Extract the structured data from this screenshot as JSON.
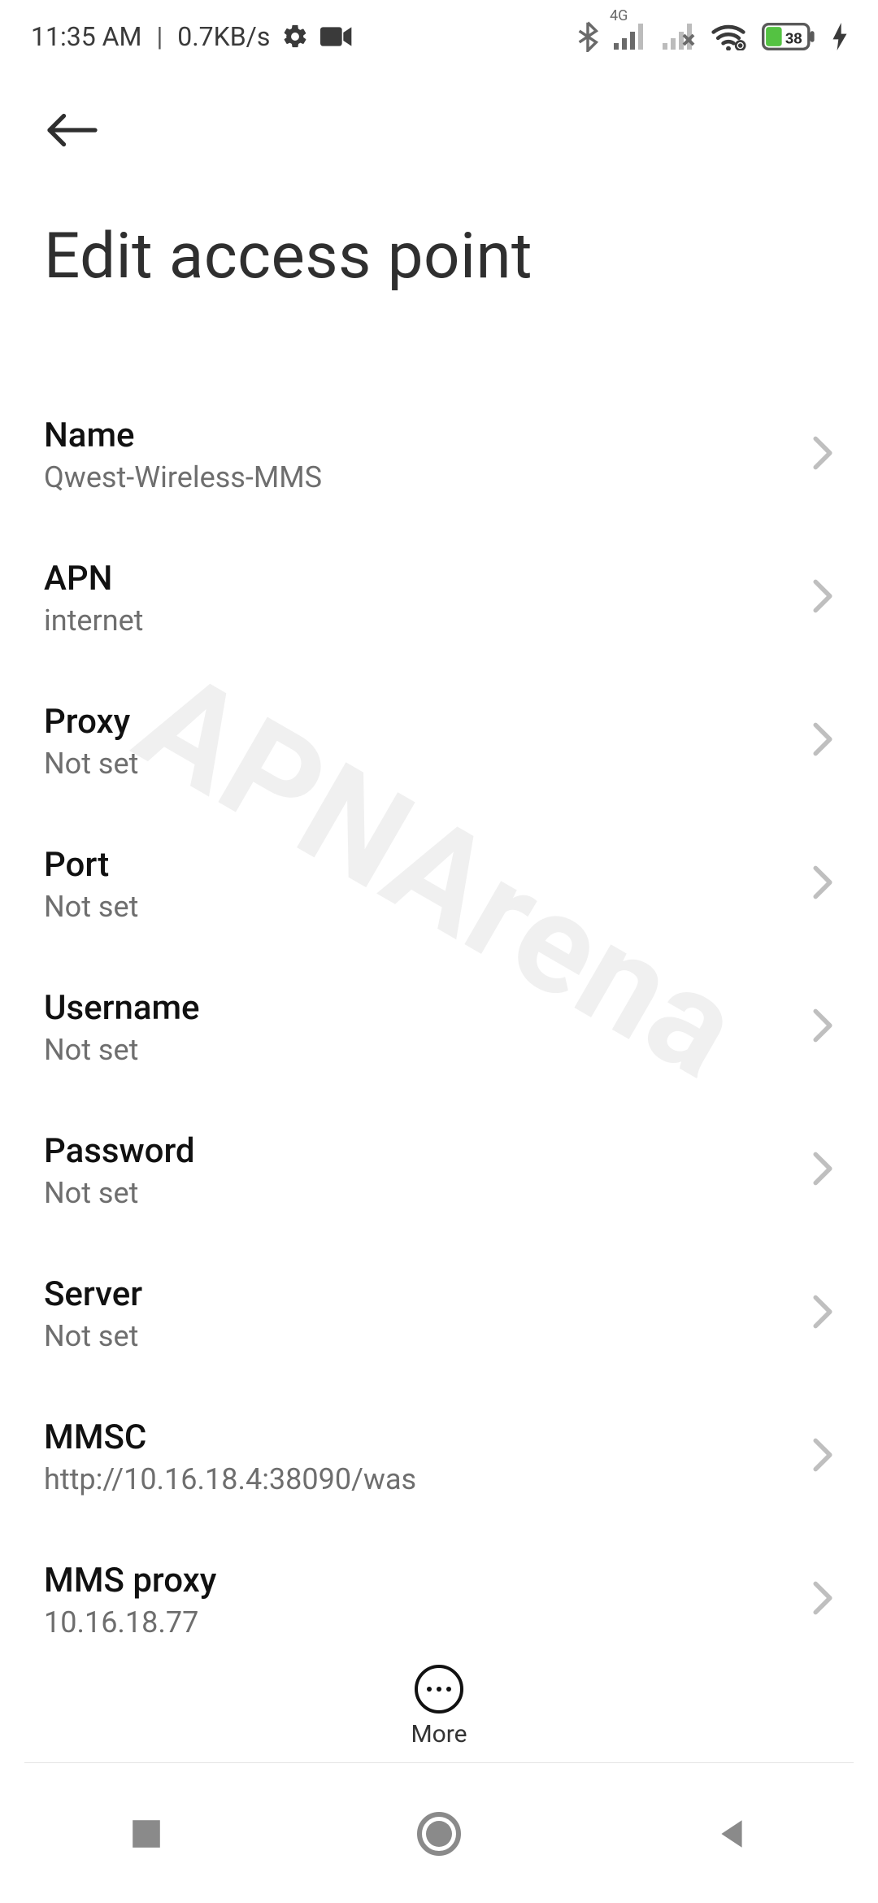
{
  "status_bar": {
    "time": "11:35 AM",
    "data_rate": "0.7KB/s",
    "signal_label": "4G",
    "battery_level": 38
  },
  "header": {
    "title": "Edit access point"
  },
  "fields": [
    {
      "label": "Name",
      "value": "Qwest-Wireless-MMS"
    },
    {
      "label": "APN",
      "value": "internet"
    },
    {
      "label": "Proxy",
      "value": "Not set"
    },
    {
      "label": "Port",
      "value": "Not set"
    },
    {
      "label": "Username",
      "value": "Not set"
    },
    {
      "label": "Password",
      "value": "Not set"
    },
    {
      "label": "Server",
      "value": "Not set"
    },
    {
      "label": "MMSC",
      "value": "http://10.16.18.4:38090/was"
    },
    {
      "label": "MMS proxy",
      "value": "10.16.18.77"
    }
  ],
  "more": {
    "label": "More"
  },
  "watermark": "APNArena"
}
